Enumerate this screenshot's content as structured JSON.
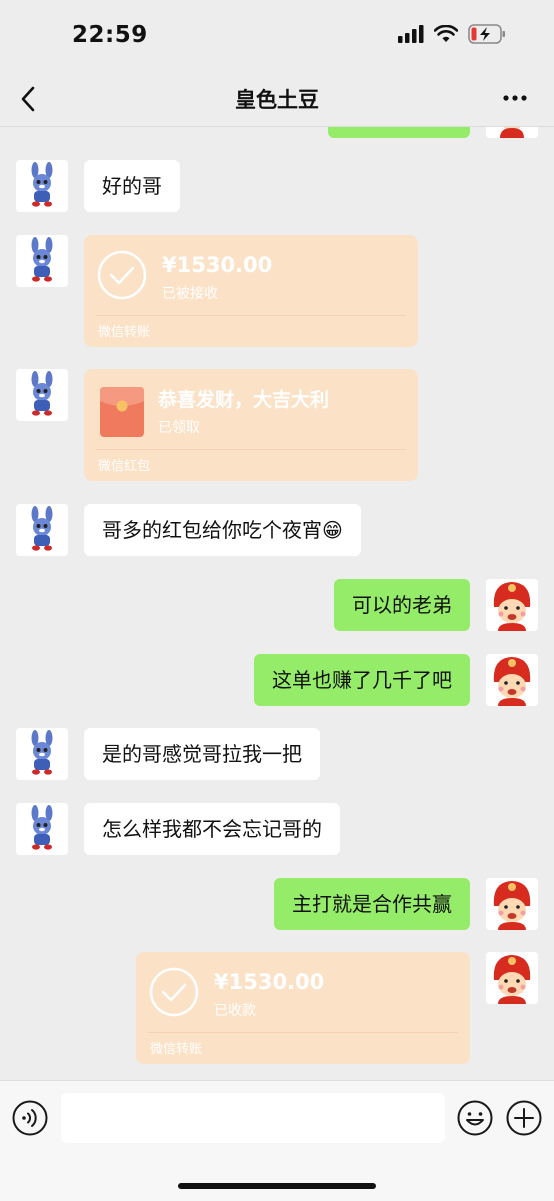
{
  "status_bar": {
    "time": "22:59"
  },
  "header": {
    "title": "皇色土豆"
  },
  "messages": {
    "m1": "好的哥",
    "transfer1": {
      "amount": "¥1530.00",
      "status": "已被接收",
      "footer": "微信转账"
    },
    "redpacket": {
      "title": "恭喜发财，大吉大利",
      "status": "已领取",
      "footer": "微信红包"
    },
    "m2": "哥多的红包给你吃个夜宵😁",
    "m3": "可以的老弟",
    "m4": "这单也赚了几千了吧",
    "m5": "是的哥感觉哥拉我一把",
    "m6": "怎么样我都不会忘记哥的",
    "m7": "主打就是合作共赢",
    "transfer2": {
      "amount": "¥1530.00",
      "status": "已收款",
      "footer": "微信转账"
    }
  },
  "input": {
    "placeholder": ""
  },
  "colors": {
    "sent_bubble": "#95ec69",
    "received_bubble": "#ffffff",
    "transfer_card": "#fbe2c7",
    "red_packet": "#f07a5e"
  }
}
